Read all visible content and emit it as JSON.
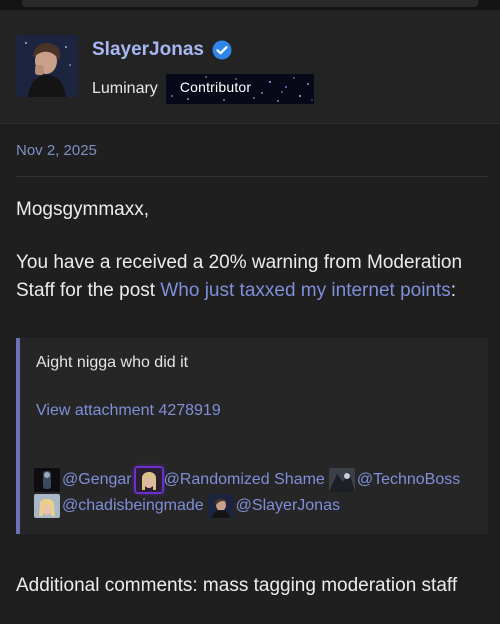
{
  "user": {
    "username": "SlayerJonas",
    "title": "Luminary",
    "banner": "Contributor"
  },
  "post": {
    "date": "Nov 2, 2025",
    "greeting": "Mogsgymmaxx,",
    "warning_prefix": "You have a received a 20% warning from Moderation Staff for the post ",
    "warning_link": "Who just taxxed my internet points",
    "warning_suffix": ":",
    "closing": "Additional comments: mass tagging moderation staff"
  },
  "quote": {
    "text": "Aight nigga who did it",
    "attachment": "View attachment 4278919",
    "mentions": [
      {
        "name": "@Gengar"
      },
      {
        "name": "@Randomized Shame"
      },
      {
        "name": "@TechnoBoss"
      },
      {
        "name": "@chadisbeingmade"
      },
      {
        "name": "@SlayerJonas"
      }
    ]
  },
  "icons": {
    "verified": "verified-check-icon"
  },
  "colors": {
    "background": "#1f1f1f",
    "username": "#a6b7f2",
    "link": "#7f8fd9",
    "quote_border": "#6c72b8",
    "verified": "#2f86e8"
  }
}
